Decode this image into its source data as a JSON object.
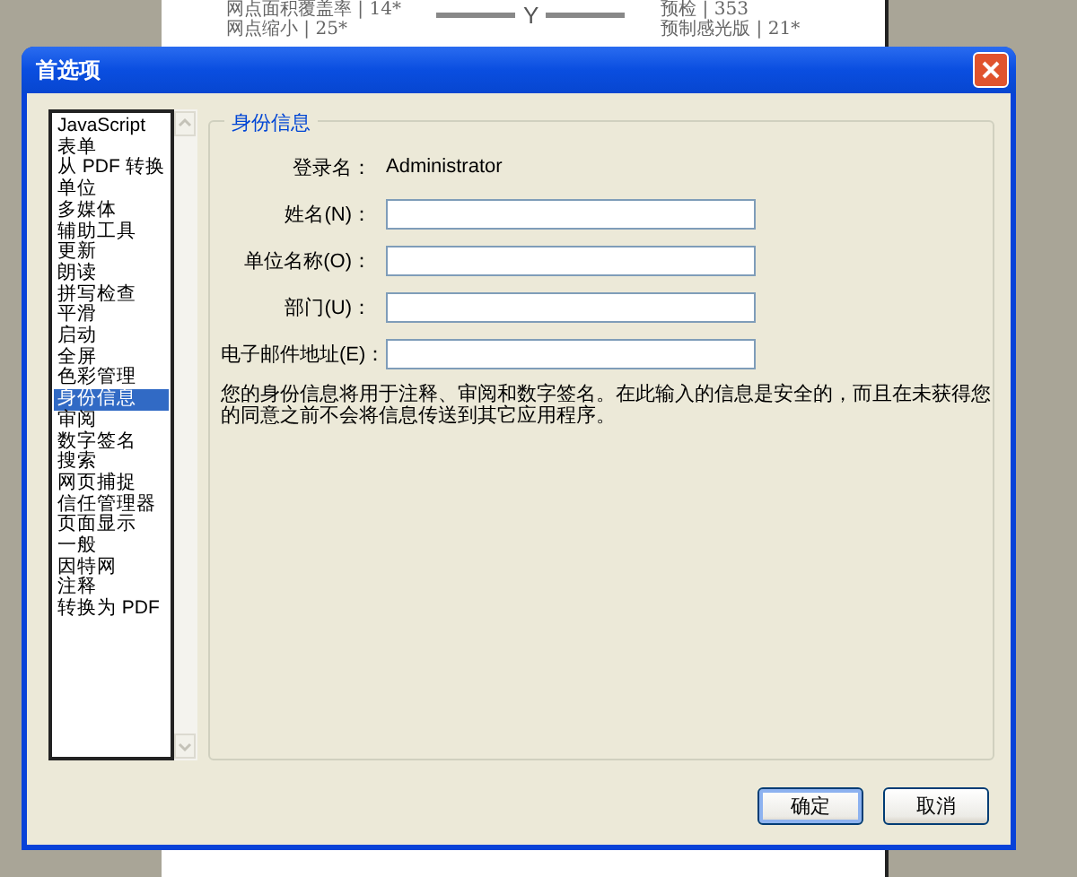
{
  "background_document": {
    "heading": "Y",
    "left_entries": [
      "网点面积覆盖率 | 14*",
      "网点缩小 | 25*"
    ],
    "right_entries": [
      "预检 | 353",
      "预制感光版 | 21*"
    ]
  },
  "window": {
    "title": "首选项"
  },
  "categories": [
    {
      "label": "JavaScript",
      "selected": false
    },
    {
      "label": "表单",
      "selected": false
    },
    {
      "label": "从 PDF 转换",
      "selected": false
    },
    {
      "label": "单位",
      "selected": false
    },
    {
      "label": "多媒体",
      "selected": false
    },
    {
      "label": "辅助工具",
      "selected": false
    },
    {
      "label": "更新",
      "selected": false
    },
    {
      "label": "朗读",
      "selected": false
    },
    {
      "label": "拼写检查",
      "selected": false
    },
    {
      "label": "平滑",
      "selected": false
    },
    {
      "label": "启动",
      "selected": false
    },
    {
      "label": "全屏",
      "selected": false
    },
    {
      "label": "色彩管理",
      "selected": false
    },
    {
      "label": "身份信息",
      "selected": true
    },
    {
      "label": "审阅",
      "selected": false
    },
    {
      "label": "数字签名",
      "selected": false
    },
    {
      "label": "搜索",
      "selected": false
    },
    {
      "label": "网页捕捉",
      "selected": false
    },
    {
      "label": "信任管理器",
      "selected": false
    },
    {
      "label": "页面显示",
      "selected": false
    },
    {
      "label": "一般",
      "selected": false
    },
    {
      "label": "因特网",
      "selected": false
    },
    {
      "label": "注释",
      "selected": false
    },
    {
      "label": "转换为 PDF",
      "selected": false
    }
  ],
  "group": {
    "title": "身份信息",
    "login": {
      "label": "登录名：",
      "value": "Administrator"
    },
    "fields": [
      {
        "label": "姓名(N)："
      },
      {
        "label": "单位名称(O)："
      },
      {
        "label": "部门(U)："
      },
      {
        "label": "电子邮件地址(E)："
      }
    ],
    "note": "您的身份信息将用于注释、审阅和数字签名。在此输入的信息是安全的，而且在未获得您的同意之前不会将信息传送到其它应用程序。"
  },
  "buttons": [
    {
      "label": "确定",
      "default": true
    },
    {
      "label": "取消",
      "default": false
    }
  ]
}
